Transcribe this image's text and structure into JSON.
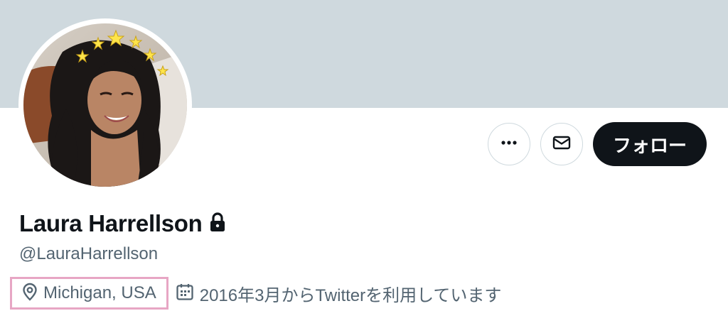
{
  "profile": {
    "display_name": "Laura Harrellson",
    "handle": "@LauraHarrellson",
    "protected_icon": "lock-icon",
    "location": "Michigan, USA",
    "location_icon": "map-pin-icon",
    "joined": "2016年3月からTwitterを利用しています",
    "joined_icon": "calendar-icon"
  },
  "actions": {
    "more_icon": "more-dots-icon",
    "message_icon": "envelope-icon",
    "follow_label": "フォロー"
  },
  "colors": {
    "banner": "#cfd9de",
    "follow_bg": "#0f1419",
    "secondary_text": "#536471",
    "highlight_border": "#e7a6c4"
  }
}
